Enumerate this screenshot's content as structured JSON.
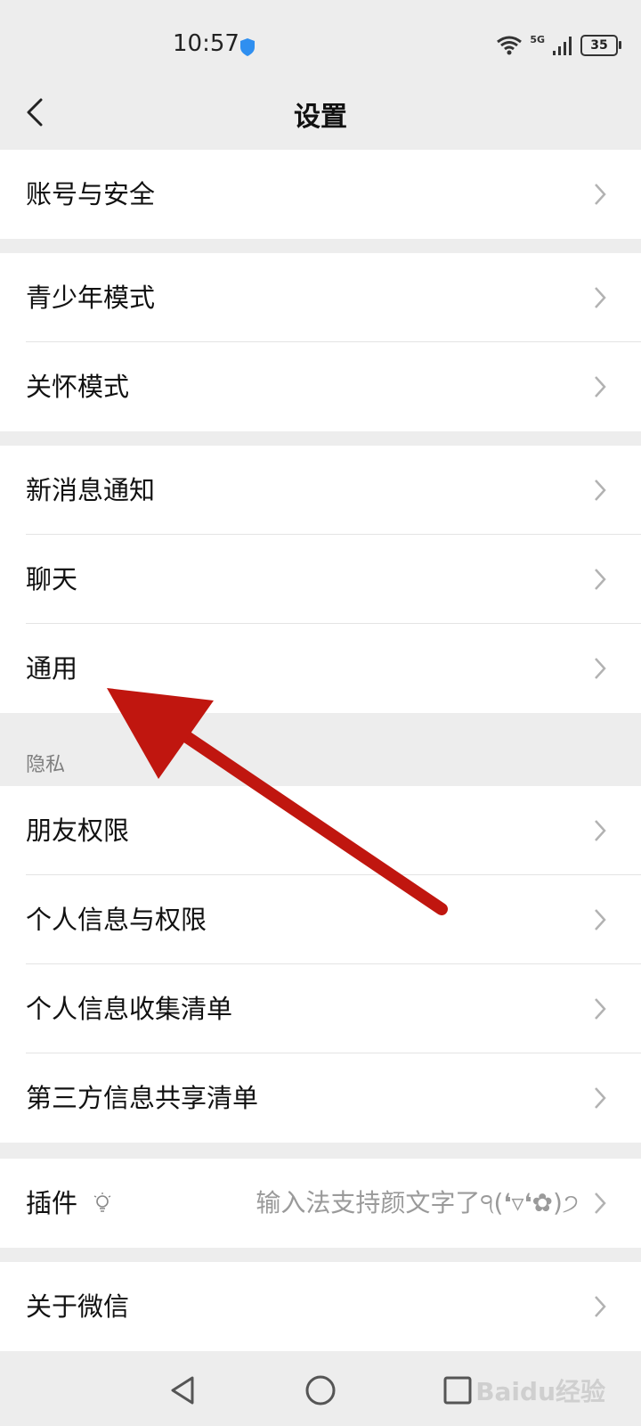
{
  "status_bar": {
    "time": "10:57",
    "network": "5G",
    "battery": "35"
  },
  "header": {
    "title": "设置",
    "back_icon": "chevron-left-icon"
  },
  "groups": [
    {
      "items": [
        {
          "label": "账号与安全"
        }
      ]
    },
    {
      "items": [
        {
          "label": "青少年模式"
        },
        {
          "label": "关怀模式"
        }
      ]
    },
    {
      "items": [
        {
          "label": "新消息通知"
        },
        {
          "label": "聊天"
        },
        {
          "label": "通用"
        }
      ]
    },
    {
      "header": "隐私",
      "items": [
        {
          "label": "朋友权限"
        },
        {
          "label": "个人信息与权限"
        },
        {
          "label": "个人信息收集清单"
        },
        {
          "label": "第三方信息共享清单"
        }
      ]
    },
    {
      "items": [
        {
          "label": "插件",
          "value": "输入法支持颜文字了੧(❛▿❛✿)੭"
        }
      ]
    },
    {
      "items": [
        {
          "label": "关于微信"
        }
      ]
    }
  ],
  "annotation": {
    "arrow_color": "#c0160f",
    "points_to": "通用"
  },
  "bottom_nav": {
    "back": "triangle-back-icon",
    "home": "circle-home-icon",
    "recents": "square-recents-icon"
  },
  "watermark": "Baidu经验",
  "colors": {
    "background": "#ededed",
    "card": "#ffffff",
    "text": "#111111",
    "secondary": "#9a9a9a"
  }
}
